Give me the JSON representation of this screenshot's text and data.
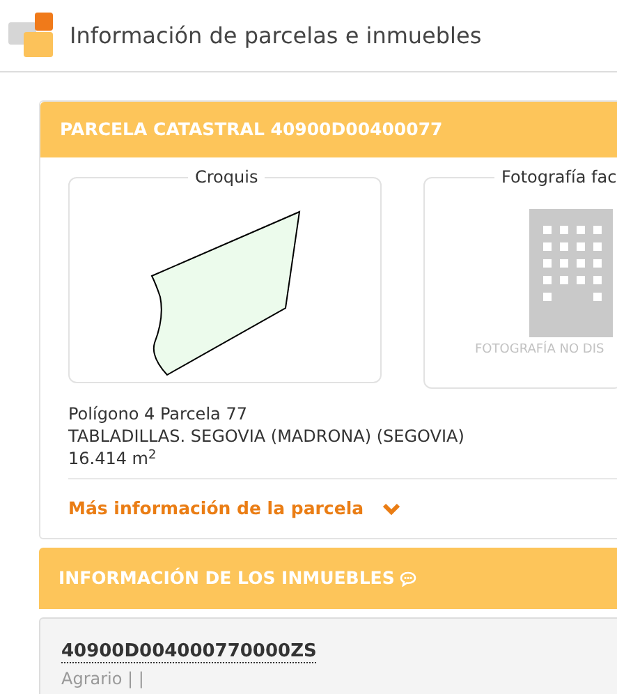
{
  "header": {
    "title": "Información de parcelas e inmuebles"
  },
  "parcel": {
    "title": "PARCELA CATASTRAL 40900D00400077",
    "sketch_legend": "Croquis",
    "photo_legend": "Fotografía fac",
    "photo_missing": "FOTOGRAFÍA NO DIS",
    "lines": [
      "Polígono 4 Parcela 77",
      "TABLADILLAS. SEGOVIA (MADRONA) (SEGOVIA)",
      "16.414 m$^{2}$"
    ],
    "more_link": "Más información de la parcela"
  },
  "properties": {
    "title": "INFORMACIÓN DE LOS INMUEBLES",
    "items": [
      {
        "reference": "40900D004000770000ZS",
        "use": "Agrario | |"
      }
    ]
  }
}
